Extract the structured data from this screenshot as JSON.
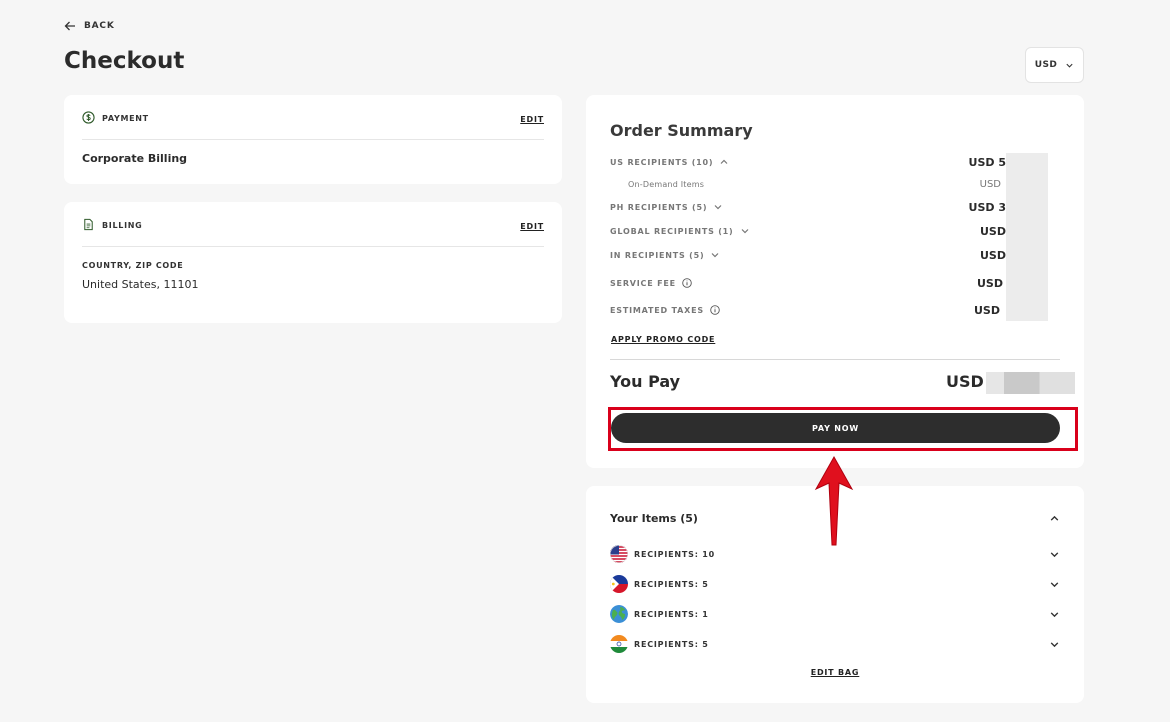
{
  "header": {
    "back_label": "BACK",
    "title": "Checkout",
    "currency": "USD"
  },
  "payment": {
    "label": "PAYMENT",
    "edit": "EDIT",
    "value": "Corporate Billing"
  },
  "billing": {
    "label": "BILLING",
    "edit": "EDIT",
    "sub_label": "COUNTRY, ZIP CODE",
    "value": "United States, 11101"
  },
  "summary": {
    "title": "Order Summary",
    "rows": [
      {
        "label": "US RECIPIENTS (10)",
        "amount": "USD 5"
      },
      {
        "label": "On-Demand Items",
        "amount": "USD"
      },
      {
        "label": "PH RECIPIENTS (5)",
        "amount": "USD 3"
      },
      {
        "label": "GLOBAL RECIPIENTS (1)",
        "amount": "USD"
      },
      {
        "label": "IN RECIPIENTS (5)",
        "amount": "USD"
      },
      {
        "label": "SERVICE FEE",
        "amount": "USD"
      },
      {
        "label": "ESTIMATED TAXES",
        "amount": "USD"
      }
    ],
    "promo": "APPLY PROMO CODE",
    "you_pay_label": "You Pay",
    "you_pay_currency": "USD",
    "pay_now": "PAY NOW"
  },
  "items": {
    "title": "Your Items (5)",
    "list": [
      {
        "label": "RECIPIENTS: 10",
        "flag": "us-flag-icon"
      },
      {
        "label": "RECIPIENTS: 5",
        "flag": "ph-flag-icon"
      },
      {
        "label": "RECIPIENTS: 1",
        "flag": "globe-icon"
      },
      {
        "label": "RECIPIENTS: 5",
        "flag": "in-flag-icon"
      }
    ],
    "edit_bag": "EDIT BAG"
  },
  "colors": {
    "accent": "#2d2d2d",
    "highlight": "#d9001b",
    "background": "#f6f6f6"
  }
}
